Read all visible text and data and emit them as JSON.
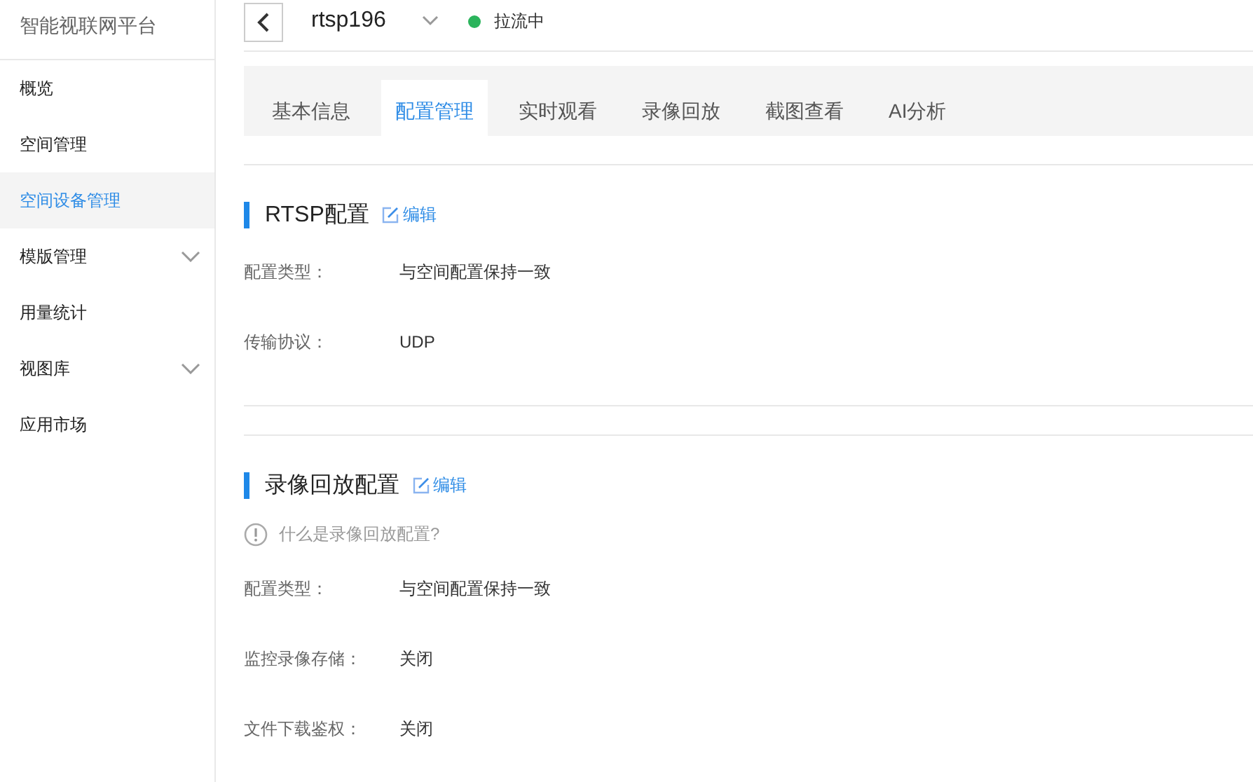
{
  "sidebar": {
    "title": "智能视联网平台",
    "items": [
      {
        "label": "概览",
        "kind": "link",
        "selected": false
      },
      {
        "label": "空间管理",
        "kind": "link",
        "selected": false
      },
      {
        "label": "空间设备管理",
        "kind": "link",
        "selected": true
      },
      {
        "label": "模版管理",
        "kind": "group",
        "selected": false
      },
      {
        "label": "用量统计",
        "kind": "link",
        "selected": false
      },
      {
        "label": "视图库",
        "kind": "group",
        "selected": false
      },
      {
        "label": "应用市场",
        "kind": "link",
        "selected": false
      }
    ]
  },
  "header": {
    "device": "rtsp196",
    "status": "拉流中"
  },
  "tabs": [
    {
      "label": "基本信息",
      "selected": false
    },
    {
      "label": "配置管理",
      "selected": true
    },
    {
      "label": "实时观看",
      "selected": false
    },
    {
      "label": "录像回放",
      "selected": false
    },
    {
      "label": "截图查看",
      "selected": false
    },
    {
      "label": "AI分析",
      "selected": false
    }
  ],
  "sections": [
    {
      "title": "RTSP配置",
      "edit": "编辑",
      "fields": [
        {
          "label": "配置类型：",
          "value": "与空间配置保持一致"
        },
        {
          "label": "传输协议：",
          "value": "UDP"
        }
      ]
    },
    {
      "title": "录像回放配置",
      "edit": "编辑",
      "hint": "什么是录像回放配置?",
      "fields": [
        {
          "label": "配置类型：",
          "value": "与空间配置保持一致"
        },
        {
          "label": "监控录像存储：",
          "value": "关闭"
        },
        {
          "label": "文件下载鉴权：",
          "value": "关闭"
        }
      ]
    }
  ]
}
